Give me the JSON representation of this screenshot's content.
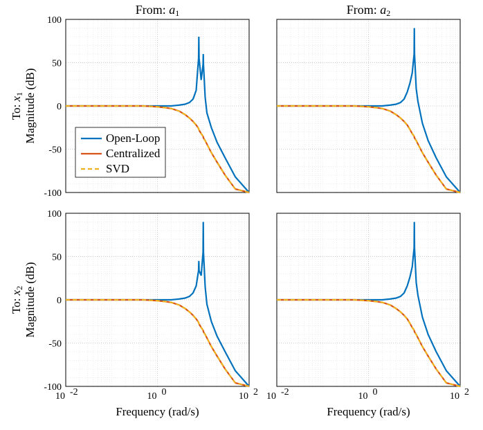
{
  "chart_data": [
    {
      "type": "line",
      "title": "From: a1",
      "ylabel_line1": "To: x1",
      "ylabel_line2": "Magnitude (dB)",
      "xscale": "log",
      "xlim": [
        0.01,
        100
      ],
      "ylim": [
        -100,
        100
      ],
      "yticks": [
        -100,
        -50,
        0,
        50,
        100
      ],
      "xticks": [
        0.01,
        1,
        100
      ],
      "xtick_labels": [
        "10^{-2}",
        "10^{0}",
        "10^{2}"
      ],
      "x": [
        0.01,
        0.02,
        0.05,
        0.1,
        0.2,
        0.5,
        1,
        1.5,
        2,
        3,
        4,
        5,
        6,
        7,
        7.9,
        8,
        8.1,
        9,
        9.9,
        10,
        10.1,
        11,
        12,
        15,
        20,
        30,
        50,
        100
      ],
      "series": [
        {
          "name": "Open-Loop",
          "color": "#0072BD",
          "dash": "none",
          "values": [
            0,
            0,
            0,
            0,
            0,
            0,
            0,
            0,
            0,
            1,
            2,
            4,
            8,
            18,
            55,
            80,
            55,
            30,
            48,
            60,
            48,
            10,
            -8,
            -25,
            -42,
            -60,
            -82,
            -100
          ]
        },
        {
          "name": "Centralized",
          "color": "#D95319",
          "dash": "none",
          "values": [
            0,
            0,
            0,
            0,
            0,
            0,
            -1,
            -2,
            -3,
            -6,
            -10,
            -14,
            -18,
            -22,
            -26,
            -27,
            -28,
            -32,
            -35,
            -36,
            -37,
            -40,
            -44,
            -54,
            -65,
            -80,
            -96,
            -100
          ]
        },
        {
          "name": "SVD",
          "color": "#EDB120",
          "dash": "6,4",
          "values": [
            0,
            0,
            0,
            0,
            0,
            0,
            -1,
            -2,
            -3,
            -6,
            -10,
            -14,
            -18,
            -22,
            -26,
            -27,
            -28,
            -32,
            -35,
            -36,
            -37,
            -40,
            -44,
            -54,
            -65,
            -80,
            -96,
            -100
          ]
        }
      ],
      "legend": [
        "Open-Loop",
        "Centralized",
        "SVD"
      ]
    },
    {
      "type": "line",
      "title": "From: a2",
      "xscale": "log",
      "xlim": [
        0.01,
        100
      ],
      "ylim": [
        -100,
        100
      ],
      "yticks": [
        -100,
        -50,
        0,
        50,
        100
      ],
      "xticks": [
        0.01,
        1,
        100
      ],
      "xtick_labels": [
        "10^{-2}",
        "10^{0}",
        "10^{2}"
      ],
      "x": [
        0.01,
        0.02,
        0.05,
        0.1,
        0.2,
        0.5,
        1,
        1.5,
        2,
        3,
        4,
        5,
        6,
        7,
        8,
        9,
        9.9,
        10,
        10.1,
        11,
        12,
        15,
        20,
        30,
        50,
        100
      ],
      "series": [
        {
          "name": "Open-Loop",
          "color": "#0072BD",
          "dash": "none",
          "values": [
            0,
            0,
            0,
            0,
            0,
            0,
            0,
            0,
            0,
            1,
            2,
            4,
            8,
            16,
            26,
            38,
            60,
            90,
            60,
            20,
            5,
            -20,
            -40,
            -60,
            -82,
            -100
          ]
        },
        {
          "name": "Centralized",
          "color": "#D95319",
          "dash": "none",
          "values": [
            0,
            0,
            0,
            0,
            0,
            0,
            -1,
            -2,
            -3,
            -6,
            -10,
            -14,
            -18,
            -22,
            -27,
            -32,
            -35,
            -36,
            -37,
            -40,
            -44,
            -54,
            -65,
            -80,
            -96,
            -100
          ]
        },
        {
          "name": "SVD",
          "color": "#EDB120",
          "dash": "6,4",
          "values": [
            0,
            0,
            0,
            0,
            0,
            0,
            -1,
            -2,
            -3,
            -6,
            -10,
            -14,
            -18,
            -22,
            -27,
            -32,
            -35,
            -36,
            -37,
            -40,
            -44,
            -54,
            -65,
            -80,
            -96,
            -100
          ]
        }
      ]
    },
    {
      "type": "line",
      "ylabel_line1": "To: x2",
      "ylabel_line2": "Magnitude (dB)",
      "xlabel": "Frequency (rad/s)",
      "xscale": "log",
      "xlim": [
        0.01,
        100
      ],
      "ylim": [
        -100,
        100
      ],
      "yticks": [
        -100,
        -50,
        0,
        50,
        100
      ],
      "xticks": [
        0.01,
        1,
        100
      ],
      "xtick_labels": [
        "10^{-2}",
        "10^{0}",
        "10^{2}"
      ],
      "x": [
        0.01,
        0.02,
        0.05,
        0.1,
        0.2,
        0.5,
        1,
        1.5,
        2,
        3,
        4,
        5,
        6,
        7,
        7.9,
        8,
        8.1,
        9,
        9.9,
        10,
        10.1,
        11,
        12,
        15,
        20,
        30,
        50,
        100
      ],
      "series": [
        {
          "name": "Open-Loop",
          "color": "#0072BD",
          "dash": "none",
          "values": [
            0,
            0,
            0,
            0,
            0,
            0,
            0,
            0,
            0,
            1,
            2,
            4,
            8,
            16,
            34,
            45,
            34,
            28,
            55,
            90,
            55,
            15,
            -5,
            -25,
            -42,
            -60,
            -82,
            -100
          ]
        },
        {
          "name": "Centralized",
          "color": "#D95319",
          "dash": "none",
          "values": [
            0,
            0,
            0,
            0,
            0,
            0,
            -1,
            -2,
            -3,
            -6,
            -10,
            -14,
            -18,
            -22,
            -26,
            -27,
            -28,
            -32,
            -35,
            -36,
            -37,
            -40,
            -44,
            -54,
            -65,
            -80,
            -96,
            -100
          ]
        },
        {
          "name": "SVD",
          "color": "#EDB120",
          "dash": "6,4",
          "values": [
            0,
            0,
            0,
            0,
            0,
            0,
            -1,
            -2,
            -3,
            -6,
            -10,
            -14,
            -18,
            -22,
            -26,
            -27,
            -28,
            -32,
            -35,
            -36,
            -37,
            -40,
            -44,
            -54,
            -65,
            -80,
            -96,
            -100
          ]
        }
      ]
    },
    {
      "type": "line",
      "xlabel": "Frequency (rad/s)",
      "xscale": "log",
      "xlim": [
        0.01,
        100
      ],
      "ylim": [
        -100,
        100
      ],
      "yticks": [
        -100,
        -50,
        0,
        50,
        100
      ],
      "xticks": [
        0.01,
        1,
        100
      ],
      "xtick_labels": [
        "10^{-2}",
        "10^{0}",
        "10^{2}"
      ],
      "x": [
        0.01,
        0.02,
        0.05,
        0.1,
        0.2,
        0.5,
        1,
        1.5,
        2,
        3,
        4,
        5,
        6,
        7,
        8,
        9,
        9.9,
        10,
        10.1,
        11,
        12,
        15,
        20,
        30,
        50,
        100
      ],
      "series": [
        {
          "name": "Open-Loop",
          "color": "#0072BD",
          "dash": "none",
          "values": [
            0,
            0,
            0,
            0,
            0,
            0,
            0,
            0,
            0,
            1,
            2,
            4,
            8,
            16,
            26,
            38,
            60,
            90,
            60,
            20,
            5,
            -20,
            -40,
            -60,
            -82,
            -100
          ]
        },
        {
          "name": "Centralized",
          "color": "#D95319",
          "dash": "none",
          "values": [
            0,
            0,
            0,
            0,
            0,
            0,
            -1,
            -2,
            -3,
            -6,
            -10,
            -14,
            -18,
            -22,
            -27,
            -32,
            -35,
            -36,
            -37,
            -40,
            -44,
            -54,
            -65,
            -80,
            -96,
            -100
          ]
        },
        {
          "name": "SVD",
          "color": "#EDB120",
          "dash": "6,4",
          "values": [
            0,
            0,
            0,
            0,
            0,
            0,
            -1,
            -2,
            -3,
            -6,
            -10,
            -14,
            -18,
            -22,
            -27,
            -32,
            -35,
            -36,
            -37,
            -40,
            -44,
            -54,
            -65,
            -80,
            -96,
            -100
          ]
        }
      ]
    }
  ]
}
